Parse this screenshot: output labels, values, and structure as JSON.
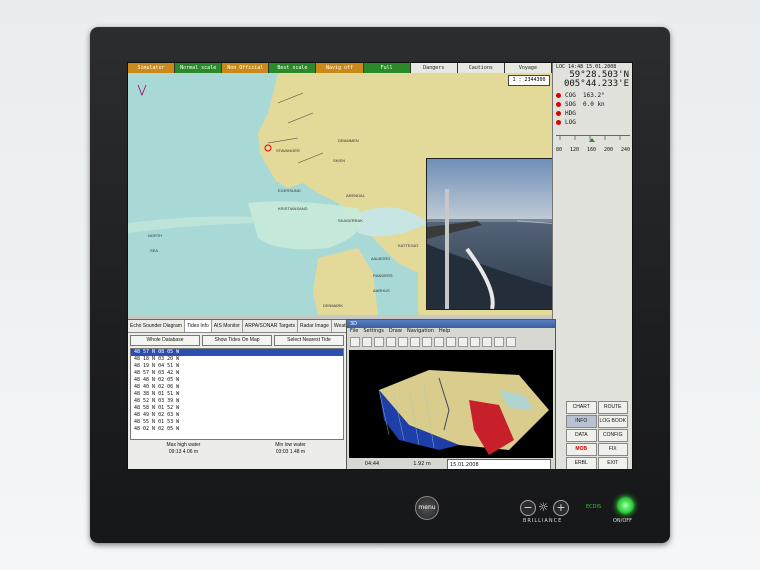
{
  "statusbar": {
    "items": [
      {
        "label": "Simulator",
        "color": "#c98a1a"
      },
      {
        "label": "Normal scale",
        "color": "#2a8a2a"
      },
      {
        "label": "Non Official",
        "color": "#c98a1a"
      },
      {
        "label": "Best scale",
        "color": "#2a8a2a"
      },
      {
        "label": "Navig off",
        "color": "#c98a1a"
      },
      {
        "label": "Full",
        "color": "#2a8a2a"
      },
      {
        "label": "Dangers",
        "color": "#e8e8e2"
      },
      {
        "label": "Cautions",
        "color": "#e8e8e2"
      },
      {
        "label": "Voyage",
        "color": "#e8e8e2"
      }
    ]
  },
  "map": {
    "scale": "1 : 2344300",
    "labels": [
      "DRAMMEN",
      "SKIEN",
      "STAVANGER",
      "EGERSUND",
      "ARENDAL",
      "KRISTIANSAND",
      "SKAGERRAK",
      "NORTH",
      "SEA",
      "AALBORG",
      "KATTEGAT",
      "RANDERS",
      "AARHUS",
      "DENMARK",
      "OREBRO"
    ]
  },
  "nav": {
    "loc_label": "LOC",
    "time": "14:48",
    "date": "15.01.2008",
    "lat": "59°28.503'N",
    "lon": "005°44.233'E",
    "rows": [
      {
        "label": "COG",
        "value": "163.2°"
      },
      {
        "label": "SOG",
        "value": "0.0 kn"
      },
      {
        "label": "HDG",
        "value": ""
      },
      {
        "label": "LOG",
        "value": ""
      }
    ],
    "ticks": [
      "80",
      "120",
      "160",
      "200",
      "240"
    ]
  },
  "side_buttons": [
    {
      "label": "CHART",
      "selected": false,
      "red": false
    },
    {
      "label": "ROUTE",
      "selected": false,
      "red": false
    },
    {
      "label": "INFO",
      "selected": true,
      "red": false
    },
    {
      "label": "LOG BOOK",
      "selected": false,
      "red": false
    },
    {
      "label": "DATA",
      "selected": false,
      "red": false
    },
    {
      "label": "CONFIG",
      "selected": false,
      "red": false
    },
    {
      "label": "MOB",
      "selected": false,
      "red": true
    },
    {
      "label": "FIX",
      "selected": false,
      "red": false
    },
    {
      "label": "ERBL",
      "selected": false,
      "red": false
    },
    {
      "label": "EXIT",
      "selected": false,
      "red": false
    }
  ],
  "info_panel": {
    "tabs": [
      "Echo Sounder Diagram",
      "Tides Info",
      "AIS Monitor",
      "ARPA/SONAR Targets",
      "Radar Image",
      "Weathe"
    ],
    "buttons": [
      "Whole Database",
      "Show Tides On Map",
      "Select Nearest Tide"
    ],
    "list": [
      "48 57 N 08 05 W",
      "48 18 N 03 20 W",
      "48 19 N 04 51 W",
      "48 57 N 03 42 W",
      "48 48 N 02 05 W",
      "48 40 N 02 06 W",
      "48 38 N 01 51 W",
      "48 52 N 03 39 W",
      "48 58 N 01 52 W",
      "48 49 N 02 03 W",
      "48 55 N 01 53 W",
      "48 02 N 02 05 W"
    ],
    "tides": [
      {
        "label": "Max high water",
        "time": "09:13",
        "value": "4.06 m"
      },
      {
        "label": "Min low water",
        "time": "03:03",
        "value": "1.48 m"
      }
    ]
  },
  "window3d": {
    "title": "3D",
    "menu": [
      "File",
      "Settings",
      "Draw",
      "Navigation",
      "Help"
    ],
    "status_time": "04:44",
    "status_depth": "1.92 m",
    "status_date": "15.01.2008"
  },
  "hardware": {
    "menu": "menu",
    "brilliance": "BRILLIANCE",
    "ecdis": "ECDIS",
    "onoff": "ON/OFF"
  }
}
